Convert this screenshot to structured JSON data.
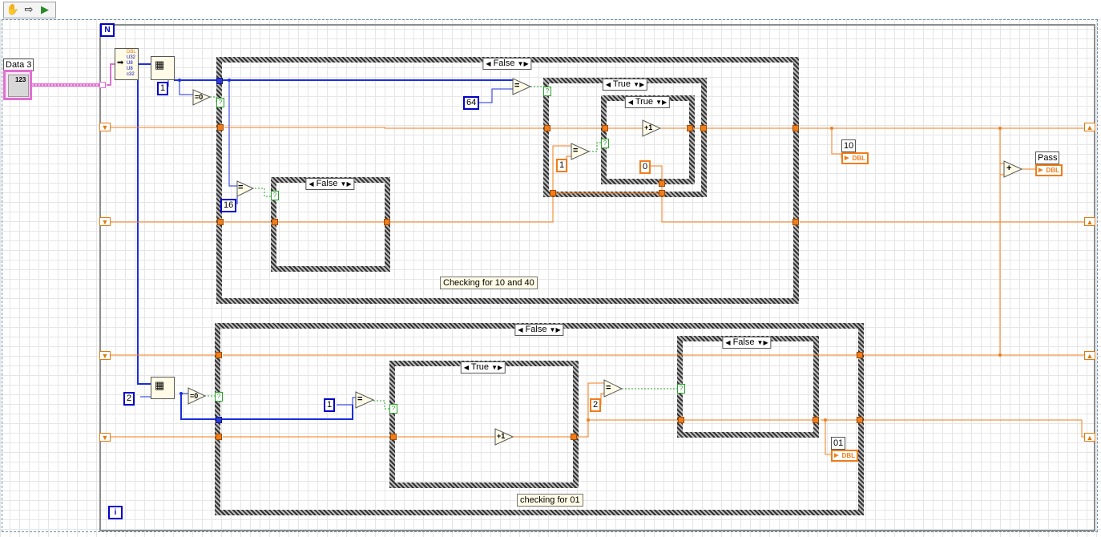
{
  "toolbar": {
    "items": [
      "hand-tool-icon",
      "arrow-run-icon",
      "run-continuous-icon"
    ]
  },
  "loop": {
    "count_terminal": "N",
    "iteration_terminal": "i"
  },
  "cluster_control": {
    "label": "Data 3",
    "badge": "123"
  },
  "unbundle": {
    "types": [
      "DBL",
      "U32",
      "U8",
      "U8",
      "c32"
    ]
  },
  "constants": {
    "index_1": "1",
    "index_2": "2",
    "c64": "64",
    "c16": "16",
    "c1_inner": "1",
    "c0": "0",
    "c1_lower": "1",
    "c2": "2"
  },
  "case_structures": {
    "outer_top": "False",
    "top_inner_left": "False",
    "top_inner_right": "True",
    "top_inner_nested": "True",
    "outer_bottom": "False",
    "bottom_inner_left": "True",
    "bottom_inner_right": "False"
  },
  "comments": {
    "top": "Checking for 10 and 40",
    "bottom": "checking for 01"
  },
  "indicators": {
    "ind_10": {
      "label": "10",
      "type": "DBL"
    },
    "ind_pass": {
      "label": "Pass",
      "type": "DBL"
    },
    "ind_01": {
      "label": "01",
      "type": "DBL"
    }
  },
  "operators": {
    "eq_zero": "=0",
    "eq": "=",
    "increment": "+1",
    "add": "+"
  },
  "wire_colors": {
    "integer": "#1a2ee0",
    "double": "#f07d1a",
    "boolean": "#2aa02a",
    "cluster": "#e070d0"
  }
}
